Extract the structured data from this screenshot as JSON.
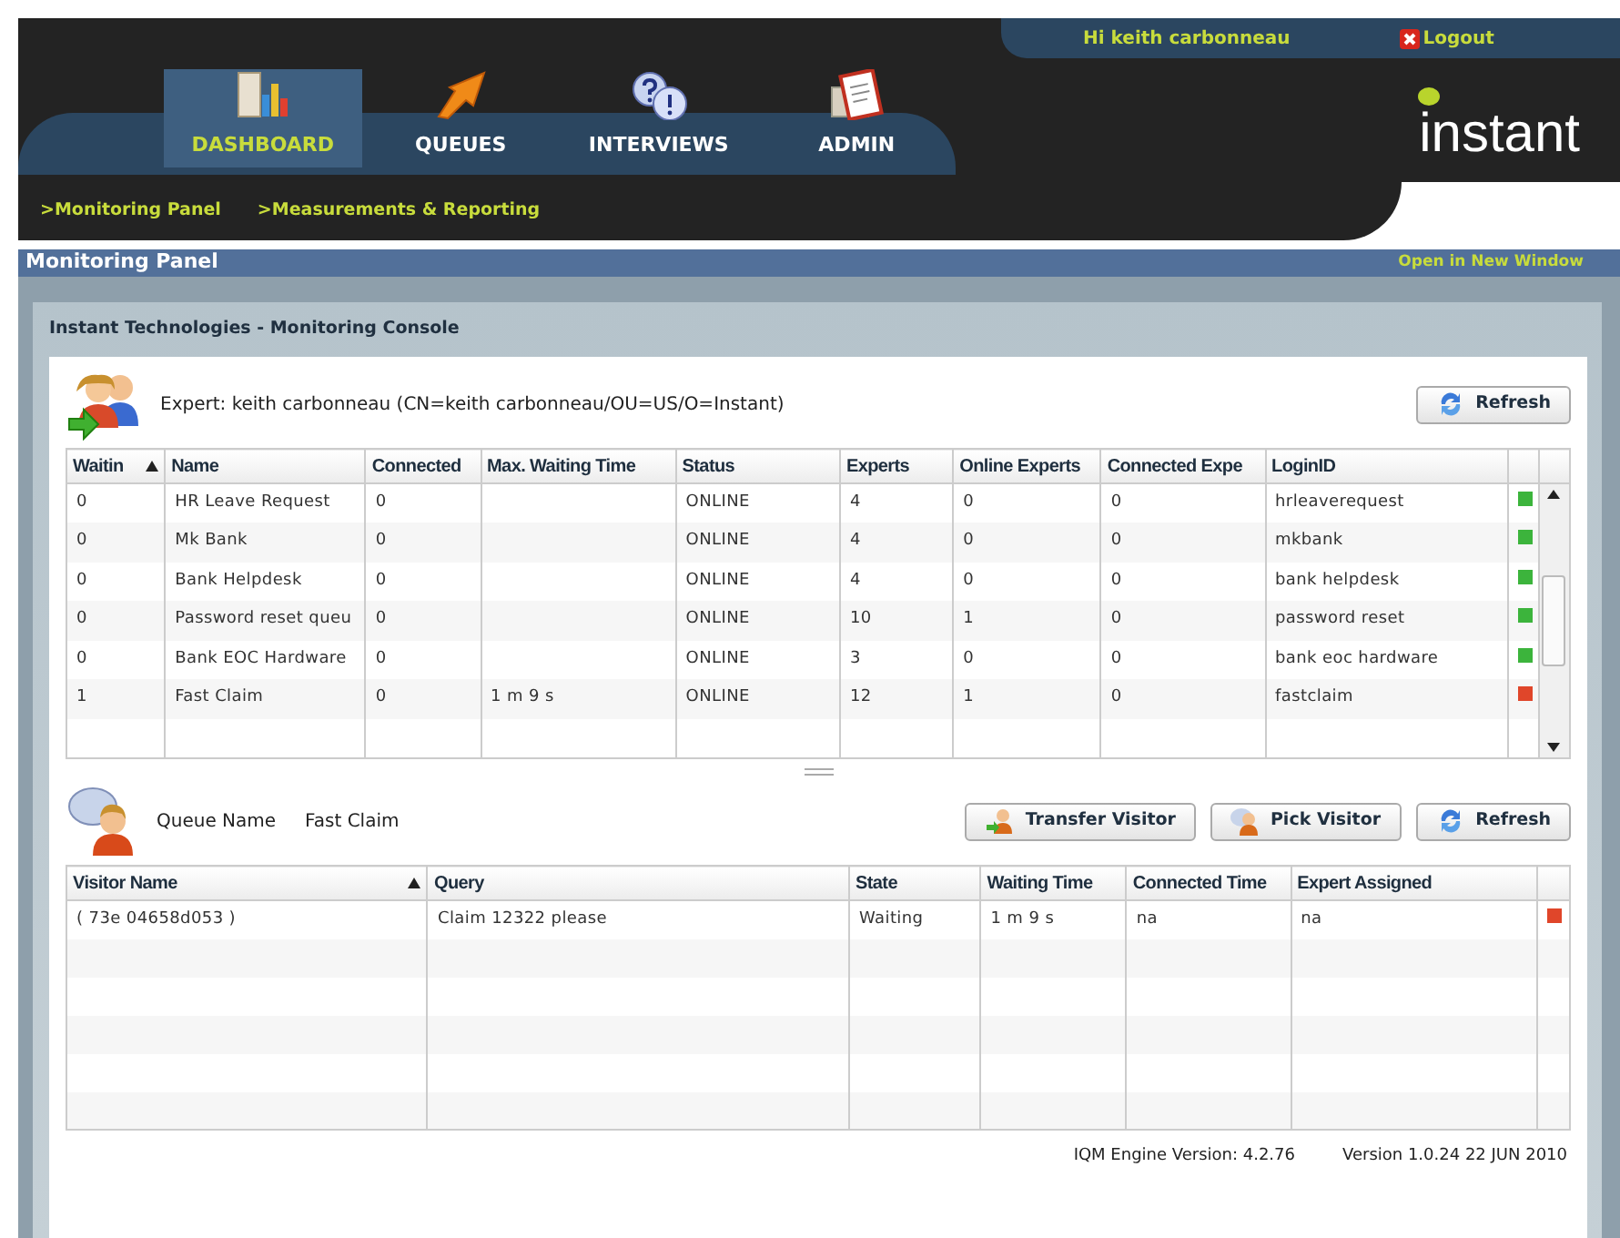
{
  "header": {
    "greeting": "Hi keith carbonneau",
    "logout": "Logout",
    "logo": "instant"
  },
  "tabs": [
    {
      "label": "DASHBOARD",
      "kind": "chart",
      "selected": true
    },
    {
      "label": "QUEUES",
      "kind": "arrow",
      "selected": false
    },
    {
      "label": "INTERVIEWS",
      "kind": "question",
      "selected": false
    },
    {
      "label": "ADMIN",
      "kind": "document",
      "selected": false
    }
  ],
  "subnav": [
    ">Monitoring Panel",
    ">Measurements & Reporting"
  ],
  "panel_bar": {
    "title": "Monitoring Panel",
    "link": "Open in New Window"
  },
  "console": {
    "title": "Instant Technologies - Monitoring Console",
    "expert": "Expert: keith carbonneau (CN=keith carbonneau/OU=US/O=Instant)",
    "refresh": "Refresh",
    "queues": {
      "columns": [
        {
          "label": "Waitin",
          "sorted": true
        },
        {
          "label": "Name",
          "sorted": false
        },
        {
          "label": "Connected",
          "sorted": false
        },
        {
          "label": "Max. Waiting Time",
          "sorted": false
        },
        {
          "label": "Status",
          "sorted": false
        },
        {
          "label": "Experts",
          "sorted": false
        },
        {
          "label": "Online Experts",
          "sorted": false
        },
        {
          "label": "Connected Expe",
          "sorted": false
        },
        {
          "label": "LoginID",
          "sorted": false
        }
      ],
      "rows": [
        {
          "cells": [
            "0",
            "HR Leave Request",
            "0",
            "",
            "ONLINE",
            "4",
            "0",
            "0",
            "hrleaverequest"
          ],
          "color": "#3cb43c"
        },
        {
          "cells": [
            "0",
            "Mk Bank",
            "0",
            "",
            "ONLINE",
            "4",
            "0",
            "0",
            "mkbank"
          ],
          "color": "#3cb43c"
        },
        {
          "cells": [
            "0",
            "Bank Helpdesk",
            "0",
            "",
            "ONLINE",
            "4",
            "0",
            "0",
            "bank helpdesk"
          ],
          "color": "#3cb43c"
        },
        {
          "cells": [
            "0",
            "Password reset queu",
            "0",
            "",
            "ONLINE",
            "10",
            "1",
            "0",
            "password reset"
          ],
          "color": "#3cb43c"
        },
        {
          "cells": [
            "0",
            "Bank EOC Hardware",
            "0",
            "",
            "ONLINE",
            "3",
            "0",
            "0",
            "bank eoc hardware"
          ],
          "color": "#3cb43c"
        },
        {
          "cells": [
            "1",
            "Fast Claim",
            "0",
            "1 m 9 s",
            "ONLINE",
            "12",
            "1",
            "0",
            "fastclaim"
          ],
          "color": "#e0462a"
        }
      ]
    },
    "visitors": {
      "queue_label": "Queue Name",
      "queue_name": "Fast Claim",
      "buttons": [
        {
          "label": "Transfer Visitor",
          "kind": "transfer"
        },
        {
          "label": "Pick Visitor",
          "kind": "pick"
        },
        {
          "label": "Refresh",
          "kind": "refresh"
        }
      ],
      "columns": [
        {
          "label": "Visitor Name",
          "sorted": true
        },
        {
          "label": "Query",
          "sorted": false
        },
        {
          "label": "State",
          "sorted": false
        },
        {
          "label": "Waiting Time",
          "sorted": false
        },
        {
          "label": "Connected Time",
          "sorted": false
        },
        {
          "label": "Expert Assigned",
          "sorted": false
        }
      ],
      "rows": [
        {
          "cells": [
            "( 73e 04658d053 )",
            "Claim 12322 please",
            "Waiting",
            "1 m 9 s",
            "na",
            "na"
          ],
          "color": "#e0462a"
        }
      ]
    },
    "footer": {
      "engine": "IQM Engine Version: 4.2.76",
      "version": "Version 1.0.24 22 JUN 2010"
    }
  }
}
